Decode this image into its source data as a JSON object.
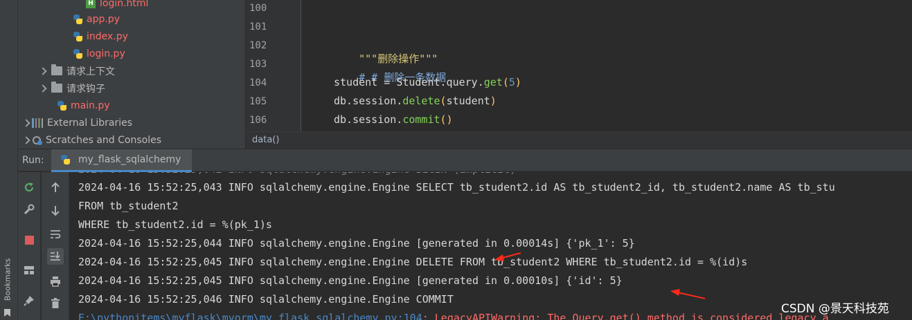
{
  "sidebar": {
    "bookmarks_label": "Bookmarks"
  },
  "project_tree": {
    "items": [
      {
        "label": "login.html",
        "kind": "html",
        "color": "#ff6b68"
      },
      {
        "label": "app.py",
        "kind": "py",
        "color": "#ff6b68"
      },
      {
        "label": "index.py",
        "kind": "py",
        "color": "#ff6b68"
      },
      {
        "label": "login.py",
        "kind": "py",
        "color": "#ff6b68"
      },
      {
        "label": "请求上下文",
        "kind": "folder",
        "color": "#bbbbbb"
      },
      {
        "label": "请求钩子",
        "kind": "folder",
        "color": "#bbbbbb"
      },
      {
        "label": "main.py",
        "kind": "py",
        "color": "#ff6b68"
      },
      {
        "label": "External Libraries",
        "kind": "libraries",
        "color": "#bbbbbb"
      },
      {
        "label": "Scratches and Consoles",
        "kind": "scratches",
        "color": "#bbbbbb"
      }
    ]
  },
  "editor": {
    "line_numbers": [
      "100",
      "101",
      "102",
      "103",
      "104",
      "105",
      "106"
    ],
    "lines": [
      {
        "docstring": "\"\"\"删除操作\"\"\""
      },
      {
        "comment": "# # 删除一条数据"
      },
      {
        "var": "student",
        "op": " = ",
        "obj": "Student.query.",
        "fn": "get",
        "open": "(",
        "num": "5",
        "close": ")"
      },
      {
        "obj": "db.session.",
        "fn": "delete",
        "open": "(",
        "arg": "student",
        "close": ")"
      },
      {
        "obj": "db.session.",
        "fn": "commit",
        "open": "(",
        "close": ")"
      }
    ],
    "breadcrumb": "data()"
  },
  "run": {
    "label": "Run:",
    "tab_label": "my_flask_sqlalchemy",
    "console_lines": [
      "2024-04-16 15:52:25,043 INFO sqlalchemy.engine.Engine SELECT tb_student2.id AS tb_student2_id, tb_student2.name AS tb_stu",
      "FROM tb_student2",
      "WHERE tb_student2.id = %(pk_1)s",
      "2024-04-16 15:52:25,044 INFO sqlalchemy.engine.Engine [generated in 0.00014s] {'pk_1': 5}",
      "2024-04-16 15:52:25,045 INFO sqlalchemy.engine.Engine DELETE FROM tb_student2 WHERE tb_student2.id = %(id)s",
      "2024-04-16 15:52:25,045 INFO sqlalchemy.engine.Engine [generated in 0.00010s] {'id': 5}",
      "2024-04-16 15:52:25,046 INFO sqlalchemy.engine.Engine COMMIT"
    ],
    "warning_path": "E:\\pythonitems\\myflask\\myorm\\my_flask_sqlalchemy.py:104",
    "warning_text": ": LegacyAPIWarning: The Query.get() method is considered legacy a"
  },
  "watermark": "CSDN @景天科技苑",
  "colors": {
    "modified_file": "#ff6b68",
    "accent": "#4a88c7",
    "arrow": "#ff2a1a"
  },
  "icons": [
    "python-icon",
    "html-icon",
    "folder-icon",
    "rerun-icon",
    "wrench-icon",
    "stop-icon",
    "layout-icon",
    "pin-icon",
    "up-arrow-icon",
    "down-arrow-icon",
    "soft-wrap-icon",
    "scroll-to-end-icon",
    "print-icon",
    "trash-icon",
    "bookmark-icon"
  ]
}
